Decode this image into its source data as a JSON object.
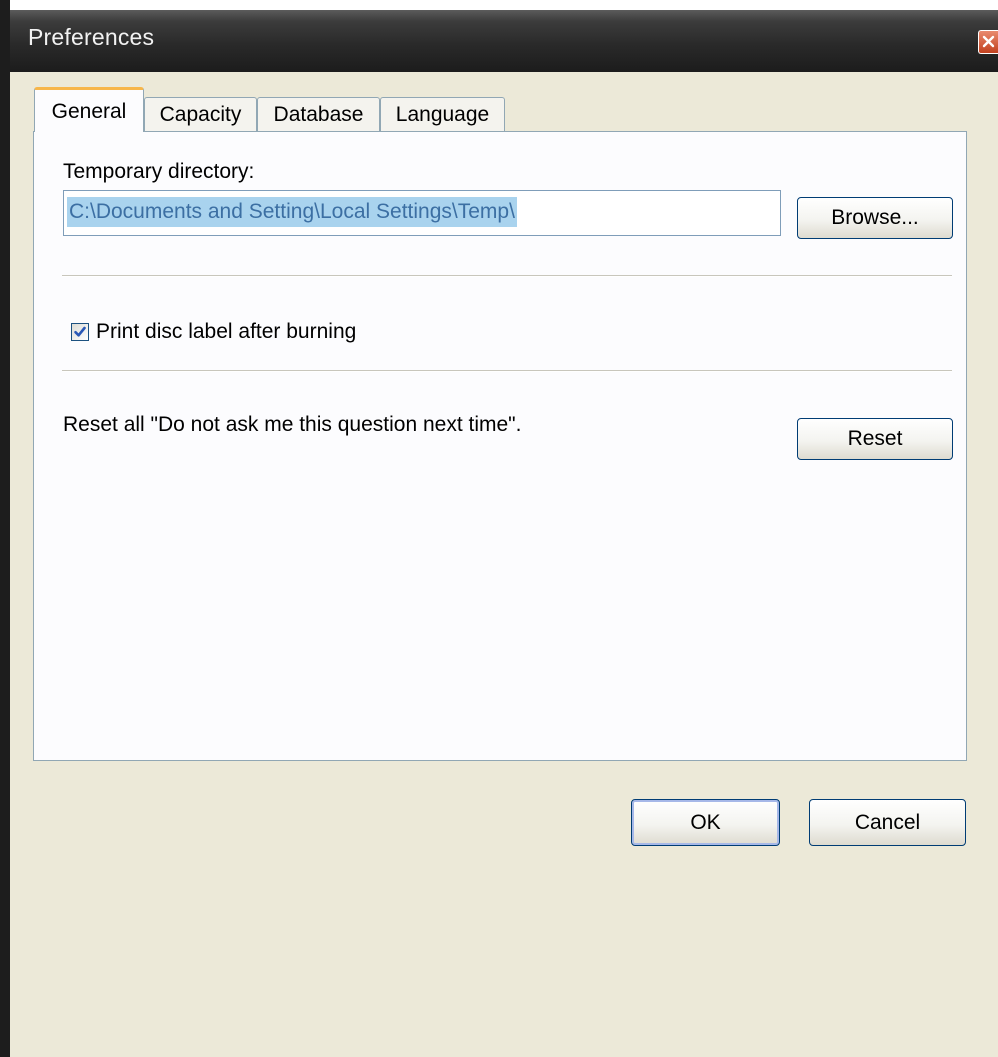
{
  "window": {
    "title": "Preferences"
  },
  "tabs": [
    {
      "label": "General",
      "active": true
    },
    {
      "label": "Capacity",
      "active": false
    },
    {
      "label": "Database",
      "active": false
    },
    {
      "label": "Language",
      "active": false
    }
  ],
  "general": {
    "temp_dir_label": "Temporary directory:",
    "temp_dir_value": "C:\\Documents and Setting\\Local Settings\\Temp\\",
    "browse_label": "Browse...",
    "print_label_text": "Print disc label after burning",
    "print_label_checked": true,
    "reset_text": "Reset all  \"Do not ask me this question next time\".",
    "reset_label": "Reset"
  },
  "footer": {
    "ok_label": "OK",
    "cancel_label": "Cancel"
  },
  "colors": {
    "titlebar": "#2a2a2a",
    "tab_active_accent": "#f7b64a",
    "selection_bg": "#a9d3ee",
    "selection_text": "#3c6fa3",
    "checkmark": "#2a58b6"
  },
  "icons": {
    "close": "close-icon",
    "check": "checkmark-icon"
  }
}
